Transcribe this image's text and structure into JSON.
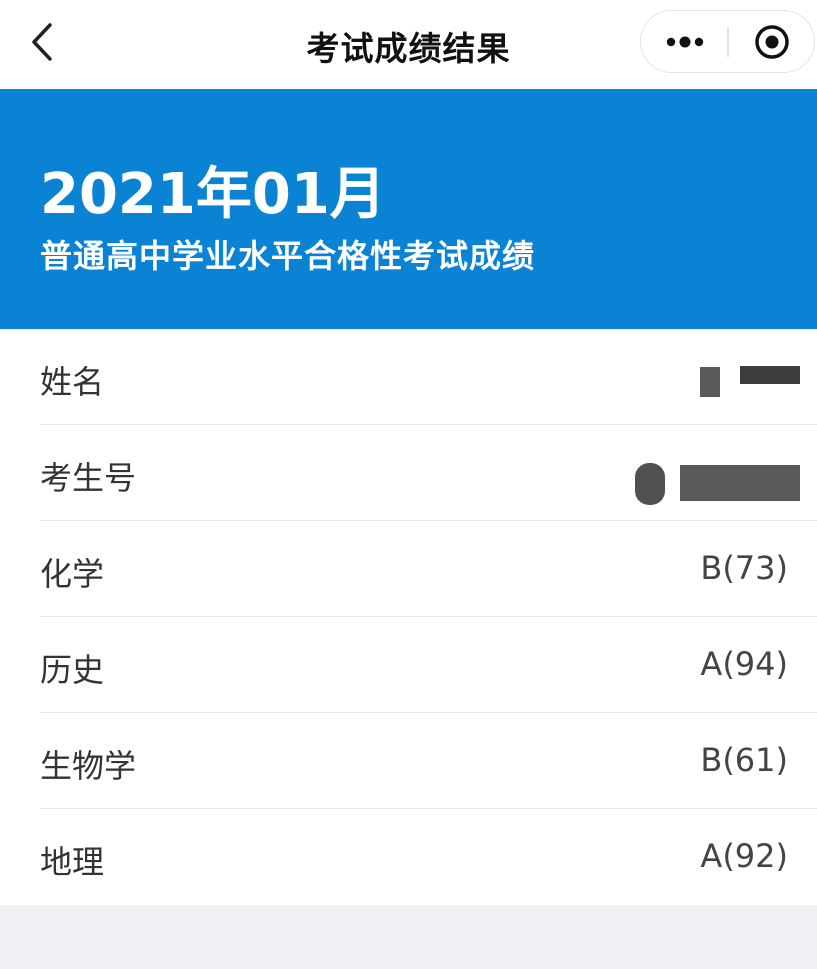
{
  "navbar": {
    "title": "考试成绩结果",
    "back_icon": "chevron-left-icon",
    "more_icon": "more-dots-icon",
    "close_icon": "target-circle-icon"
  },
  "header": {
    "date": "2021年01月",
    "subtitle": "普通高中学业水平合格性考试成绩",
    "background": "#0b83d4"
  },
  "results": [
    {
      "label": "姓名",
      "value": ""
    },
    {
      "label": "考生号",
      "value": ""
    },
    {
      "label": "化学",
      "value": "B(73)"
    },
    {
      "label": "历史",
      "value": "A(94)"
    },
    {
      "label": "生物学",
      "value": "B(61)"
    },
    {
      "label": "地理",
      "value": "A(92)"
    }
  ]
}
